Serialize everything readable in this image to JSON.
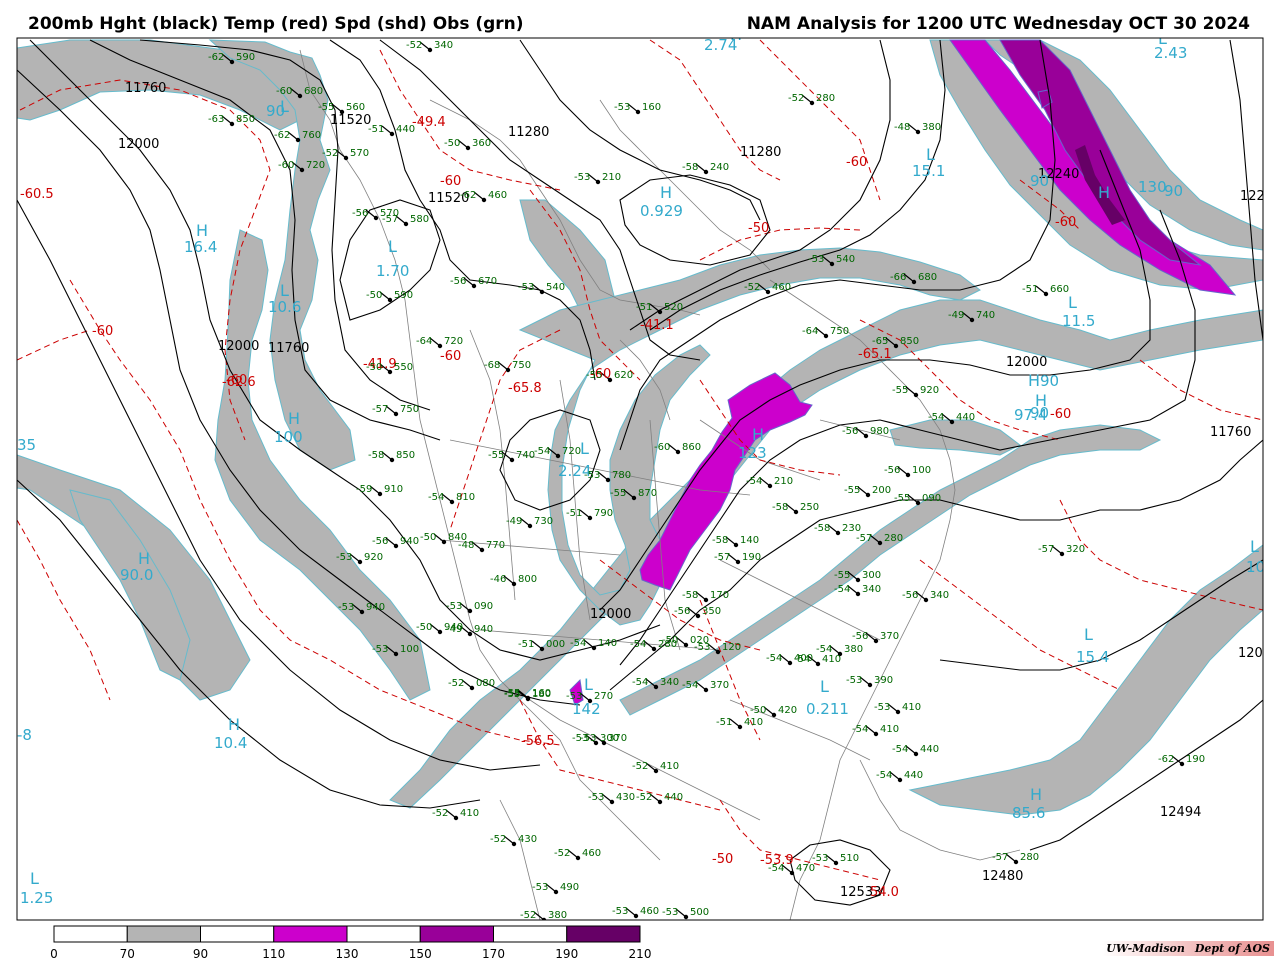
{
  "header": {
    "left_title": "200mb Hght (black) Temp (red) Spd (shd) Obs (grn)",
    "right_title": "NAM Analysis for 1200 UTC Wednesday  OCT 30 2024"
  },
  "credit": {
    "org": "UW-Madison",
    "dept": "Dept of AOS"
  },
  "colors": {
    "height_contour": "#000000",
    "temperature_contour": "#cc0000",
    "speed_70_90": "#b4b4b4",
    "speed_110_130": "#cc00cc",
    "speed_150_170": "#990099",
    "speed_190_210": "#660066",
    "observations": "#006600",
    "extrema_labels": "#33aacc",
    "geography": "#808080"
  },
  "colorbar": {
    "labels": [
      "0",
      "70",
      "90",
      "110",
      "130",
      "150",
      "170",
      "190",
      "210"
    ],
    "fills": [
      "#ffffff",
      "#b4b4b4",
      "#ffffff",
      "#cc00cc",
      "#ffffff",
      "#990099",
      "#ffffff",
      "#660066"
    ]
  },
  "height_labels": [
    "11760",
    "12000",
    "11520",
    "11280",
    "11280",
    "11520",
    "12000",
    "11760",
    "11760",
    "12000",
    "12000",
    "12240",
    "12494",
    "12480",
    "12533",
    "122",
    "12000"
  ],
  "temperature_labels": [
    "-60.5",
    "-60",
    "-62.6",
    "-41.9",
    "-60",
    "-49.4",
    "-60",
    "-65.8",
    "-41.1",
    "-60",
    "-60",
    "-65.1",
    "-60",
    "-50",
    "-60",
    "-60",
    "-56.5",
    "-50",
    "-53.9",
    "54.0"
  ],
  "extrema_letters": [
    "H",
    "L",
    "H",
    "L",
    "L",
    "H",
    "H",
    "H",
    "L",
    "H",
    "L",
    "L",
    "H",
    "L",
    "H",
    "L",
    "L",
    "H",
    "H",
    "L",
    "L",
    "L",
    "H"
  ],
  "extrema_values": [
    "2.74",
    "2.43",
    "16.4",
    "1.70",
    "10.6",
    "100",
    "90.0",
    "10.4",
    "1.25",
    "0.929",
    "15.1",
    "11.5",
    "97.4",
    "2.24",
    "123",
    "15.4",
    "0.211",
    "85.6",
    "90",
    "90",
    "130",
    "90",
    "35",
    "-8",
    "10",
    "90",
    "90",
    "142"
  ],
  "observations": [
    [
      "-62",
      "590"
    ],
    [
      "-60",
      "680"
    ],
    [
      "-63",
      "850"
    ],
    [
      "-62",
      "760"
    ],
    [
      "-60",
      "720"
    ],
    [
      "-55",
      "560"
    ],
    [
      "-52",
      "570"
    ],
    [
      "-51",
      "440"
    ],
    [
      "-52",
      "340"
    ],
    [
      "-50",
      "360"
    ],
    [
      "-62",
      "460"
    ],
    [
      "-53",
      "160"
    ],
    [
      "-53",
      "210"
    ],
    [
      "-58",
      "240"
    ],
    [
      "-48",
      "380"
    ],
    [
      "-52",
      "280"
    ],
    [
      "-56",
      "570"
    ],
    [
      "-57",
      "580"
    ],
    [
      "-56",
      "670"
    ],
    [
      "-53",
      "540"
    ],
    [
      "-50",
      "590"
    ],
    [
      "-64",
      "720"
    ],
    [
      "-68",
      "750"
    ],
    [
      "-55",
      "620"
    ],
    [
      "-51",
      "520"
    ],
    [
      "-52",
      "460"
    ],
    [
      "-53",
      "540"
    ],
    [
      "-66",
      "680"
    ],
    [
      "-64",
      "750"
    ],
    [
      "-65",
      "850"
    ],
    [
      "-51",
      "660"
    ],
    [
      "-49",
      "740"
    ],
    [
      "-50",
      "550"
    ],
    [
      "-57",
      "750"
    ],
    [
      "-58",
      "850"
    ],
    [
      "-55",
      "740"
    ],
    [
      "-54",
      "720"
    ],
    [
      "-59",
      "910"
    ],
    [
      "-54",
      "810"
    ],
    [
      "-53",
      "780"
    ],
    [
      "-55",
      "870"
    ],
    [
      "-60",
      "860"
    ],
    [
      "-51",
      "790"
    ],
    [
      "-49",
      "730"
    ],
    [
      "-50",
      "840"
    ],
    [
      "-56",
      "940"
    ],
    [
      "-53",
      "920"
    ],
    [
      "-48",
      "770"
    ],
    [
      "-53",
      "940"
    ],
    [
      "-46",
      "800"
    ],
    [
      "-53",
      "090"
    ],
    [
      "-50",
      "940"
    ],
    [
      "-49",
      "940"
    ],
    [
      "-51",
      "000"
    ],
    [
      "-53",
      "100"
    ],
    [
      "-54",
      "140"
    ],
    [
      "-54",
      "280"
    ],
    [
      "-55",
      "180"
    ],
    [
      "-53",
      "270"
    ],
    [
      "-53",
      "300"
    ],
    [
      "-53",
      "370"
    ],
    [
      "-54",
      "340"
    ],
    [
      "-54",
      "370"
    ],
    [
      "-51",
      "410"
    ],
    [
      "-50",
      "420"
    ],
    [
      "-52",
      "410"
    ],
    [
      "-54",
      "410"
    ],
    [
      "-54",
      "400"
    ],
    [
      "-54",
      "380"
    ],
    [
      "-56",
      "370"
    ],
    [
      "-53",
      "390"
    ],
    [
      "-53",
      "410"
    ],
    [
      "-54",
      "410"
    ],
    [
      "-54",
      "440"
    ],
    [
      "-54",
      "440"
    ],
    [
      "-62",
      "190"
    ],
    [
      "-57",
      "320"
    ],
    [
      "-56",
      "340"
    ],
    [
      "-54",
      "340"
    ],
    [
      "-55",
      "300"
    ],
    [
      "-57",
      "280"
    ],
    [
      "-58",
      "230"
    ],
    [
      "-58",
      "250"
    ],
    [
      "-57",
      "190"
    ],
    [
      "-58",
      "140"
    ],
    [
      "-54",
      "210"
    ],
    [
      "-55",
      "200"
    ],
    [
      "-58",
      "170"
    ],
    [
      "-55",
      "090"
    ],
    [
      "-56",
      "100"
    ],
    [
      "-56",
      "980"
    ],
    [
      "-55",
      "920"
    ],
    [
      "-54",
      "440"
    ],
    [
      "-52",
      "410"
    ],
    [
      "-52",
      "440"
    ],
    [
      "-53",
      "430"
    ],
    [
      "-52",
      "430"
    ],
    [
      "-52",
      "460"
    ],
    [
      "-53",
      "490"
    ],
    [
      "-52",
      "380"
    ],
    [
      "-53",
      "460"
    ],
    [
      "-53",
      "500"
    ],
    [
      "-53",
      "510"
    ],
    [
      "-54",
      "470"
    ],
    [
      "-57",
      "280"
    ],
    [
      "-56",
      "350"
    ],
    [
      "-53",
      "120"
    ],
    [
      "-50",
      "020"
    ],
    [
      "-52",
      "080"
    ],
    [
      "-55",
      "160"
    ]
  ]
}
